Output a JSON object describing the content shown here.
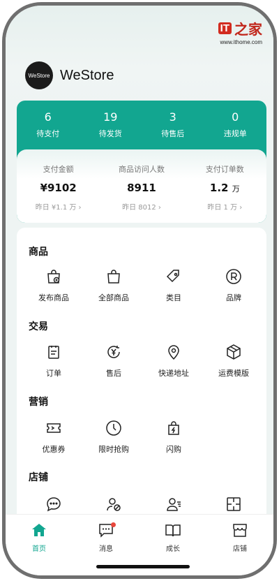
{
  "watermark": {
    "logo": "IT",
    "char": "之家",
    "url": "www.ithome.com"
  },
  "brand": {
    "avatar_text": "WeStore",
    "name": "WeStore"
  },
  "order_status": [
    {
      "count": "6",
      "label": "待支付"
    },
    {
      "count": "19",
      "label": "待发货"
    },
    {
      "count": "3",
      "label": "待售后"
    },
    {
      "count": "0",
      "label": "违规单"
    }
  ],
  "stats": [
    {
      "label": "支付金额",
      "value": "¥9102",
      "unit": "",
      "sub": "昨日 ¥1.1 万 ›"
    },
    {
      "label": "商品访问人数",
      "value": "8911",
      "unit": "",
      "sub": "昨日 8012 ›"
    },
    {
      "label": "支付订单数",
      "value": "1.2",
      "unit": "万",
      "sub": "昨日 1 万 ›"
    }
  ],
  "sections": {
    "goods": {
      "title": "商品",
      "items": [
        "发布商品",
        "全部商品",
        "类目",
        "品牌"
      ]
    },
    "trade": {
      "title": "交易",
      "items": [
        "订单",
        "售后",
        "快递地址",
        "运费模版"
      ]
    },
    "marketing": {
      "title": "营销",
      "items": [
        "优惠券",
        "限时抢购",
        "闪购"
      ]
    },
    "shop": {
      "title": "店铺"
    }
  },
  "tabs": [
    {
      "label": "首页",
      "icon": "home-icon",
      "active": true
    },
    {
      "label": "消息",
      "icon": "message-icon",
      "badge": true
    },
    {
      "label": "成长",
      "icon": "book-icon"
    },
    {
      "label": "店铺",
      "icon": "store-icon"
    }
  ],
  "colors": {
    "accent": "#12a690",
    "badge": "#e8473c"
  }
}
